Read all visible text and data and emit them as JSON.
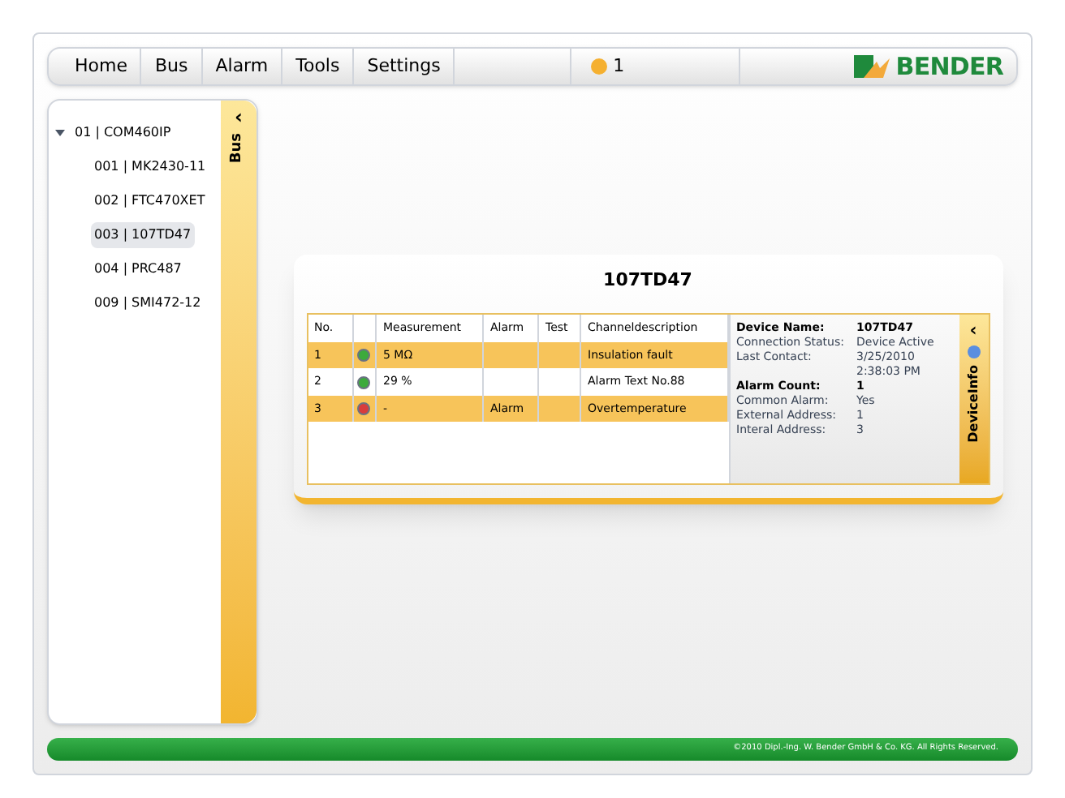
{
  "menu": [
    {
      "label": "Home"
    },
    {
      "label": "Bus"
    },
    {
      "label": "Alarm"
    },
    {
      "label": "Tools"
    },
    {
      "label": "Settings"
    }
  ],
  "alarm_indicator": {
    "count": "1"
  },
  "logo": {
    "text": "BENDER"
  },
  "bus_panel": {
    "tab_label": "Bus",
    "collapse": "‹",
    "tree": [
      {
        "label": "01 | COM460IP",
        "expanded": true,
        "selected": false,
        "children": [
          {
            "label": "001 | MK2430-11",
            "selected": false
          },
          {
            "label": "002 | FTC470XET",
            "selected": false
          },
          {
            "label": "003 | 107TD47",
            "selected": true
          },
          {
            "label": "004 | PRC487",
            "selected": false
          },
          {
            "label": "009 | SMI472-12",
            "selected": false
          }
        ]
      }
    ]
  },
  "device_card": {
    "title": "107TD47",
    "table": {
      "columns": [
        "No.",
        "",
        "Measurement",
        "Alarm",
        "Test",
        "Channeldescription"
      ],
      "rows": [
        {
          "no": "1",
          "color": "#3caa3c",
          "measurement": "5 MΩ",
          "alarm": "",
          "test": "",
          "description": "Insulation fault"
        },
        {
          "no": "2",
          "color": "#3caa3c",
          "measurement": "29 %",
          "alarm": "",
          "test": "",
          "description": "Alarm Text No.88"
        },
        {
          "no": "3",
          "color": "#d83c3c",
          "measurement": "-",
          "alarm": "Alarm",
          "test": "",
          "description": "Overtemperature"
        }
      ]
    },
    "device_info": {
      "tab_label": "DeviceInfo",
      "collapse": "‹",
      "fields": [
        {
          "label": "Device Name:",
          "value": "107TD47",
          "bold": true
        },
        {
          "label": "Connection Status:",
          "value": "Device Active",
          "bold": false
        },
        {
          "label": "Last Contact:",
          "value": "3/25/2010 2:38:03 PM",
          "bold": false
        },
        {
          "label": "Alarm Count:",
          "value": "1",
          "bold": true
        },
        {
          "label": "Common Alarm:",
          "value": "Yes",
          "bold": false
        },
        {
          "label": "External Address:",
          "value": "1",
          "bold": false
        },
        {
          "label": "Interal Address:",
          "value": "3",
          "bold": false
        }
      ]
    }
  },
  "footer": {
    "text": "©2010 Dipl.-Ing. W. Bender GmbH & Co. KG. All Rights Reserved."
  }
}
